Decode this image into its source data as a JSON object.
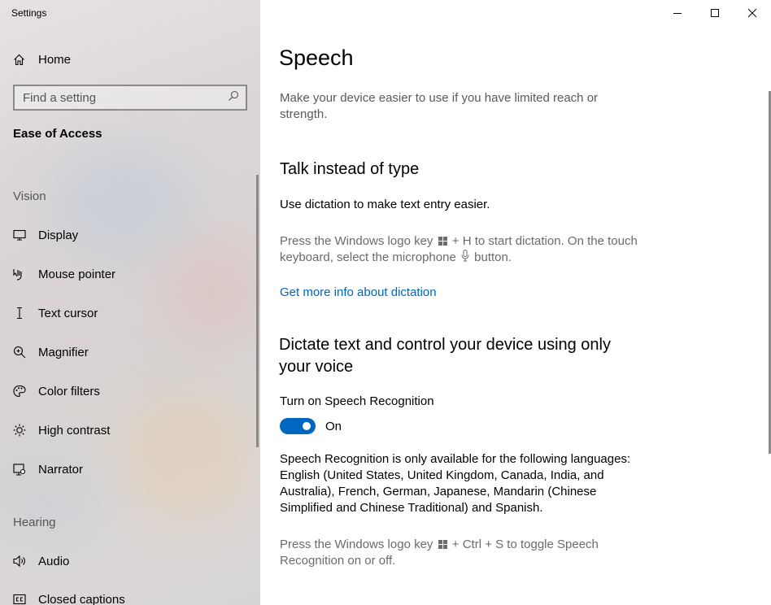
{
  "window": {
    "title": "Settings"
  },
  "sidebar": {
    "home_label": "Home",
    "search_placeholder": "Find a setting",
    "section_title": "Ease of Access",
    "groups": [
      {
        "label": "Vision",
        "items": [
          {
            "label": "Display",
            "icon": "display-icon"
          },
          {
            "label": "Mouse pointer",
            "icon": "mouse-pointer-icon"
          },
          {
            "label": "Text cursor",
            "icon": "text-cursor-icon"
          },
          {
            "label": "Magnifier",
            "icon": "magnifier-icon"
          },
          {
            "label": "Color filters",
            "icon": "color-filters-icon"
          },
          {
            "label": "High contrast",
            "icon": "high-contrast-icon"
          },
          {
            "label": "Narrator",
            "icon": "narrator-icon"
          }
        ]
      },
      {
        "label": "Hearing",
        "items": [
          {
            "label": "Audio",
            "icon": "audio-icon"
          },
          {
            "label": "Closed captions",
            "icon": "closed-captions-icon"
          }
        ]
      }
    ]
  },
  "main": {
    "title": "Speech",
    "description": "Make your device easier to use if you have limited reach or strength.",
    "talk": {
      "heading": "Talk instead of type",
      "subtitle": "Use dictation to make text entry easier.",
      "hint_part1": "Press the Windows logo key",
      "hint_part2": "+ H to start dictation.  On the touch keyboard, select the microphone",
      "hint_part3": "button.",
      "link": "Get more info about dictation"
    },
    "dictate": {
      "heading": "Dictate text and control your device using only your voice",
      "toggle_label": "Turn on Speech Recognition",
      "toggle_state": "On",
      "languages": "Speech Recognition is only available for the following languages: English (United States, United Kingdom, Canada, India, and Australia), French, German, Japanese, Mandarin (Chinese Simplified and Chinese Traditional) and Spanish.",
      "hint_part1": "Press the Windows logo key",
      "hint_part2": "+ Ctrl + S to toggle Speech Recognition on or off."
    }
  },
  "colors": {
    "accent": "#0067c0",
    "sidebar_bg": "#dcd7d8"
  }
}
